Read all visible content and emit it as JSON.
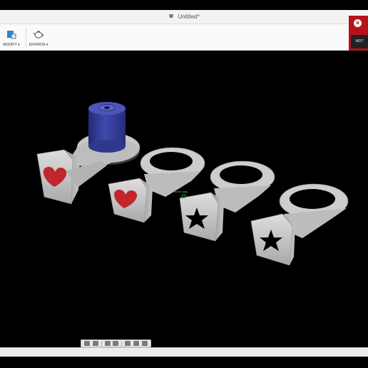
{
  "window": {
    "title": "Untitled*"
  },
  "ribbon": {
    "items": [
      {
        "label": "MODIFY ▾",
        "icon": "modify-icon"
      },
      {
        "label": "ENVIRON ▾",
        "icon": "teapot-render-icon"
      }
    ]
  },
  "notification": {
    "label": "MOT"
  },
  "viewport": {
    "cursor_hint": "move copy",
    "models": [
      {
        "symbol": "heart",
        "has_cylinder": true
      },
      {
        "symbol": "heart",
        "has_cylinder": false
      },
      {
        "symbol": "star",
        "has_cylinder": false
      },
      {
        "symbol": "star",
        "has_cylinder": false
      }
    ]
  },
  "colors": {
    "accent": "#b5121b",
    "part": "#c8c8c8",
    "heart": "#c0262b",
    "cylinder": "#3a44a6"
  }
}
